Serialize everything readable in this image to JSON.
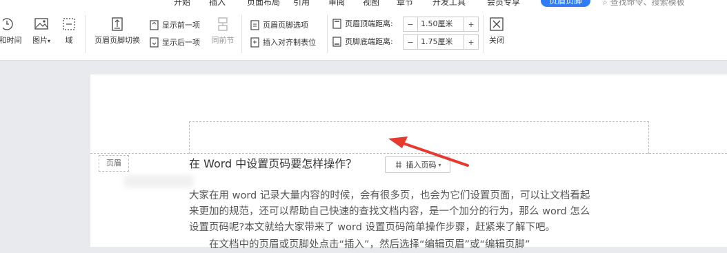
{
  "ribbon_tabs": [
    "开始",
    "插入",
    "页面布局",
    "引用",
    "审阅",
    "视图",
    "章节",
    "开发工具",
    "会员专享",
    "页眉页脚"
  ],
  "search_placeholder": "查找命令、搜索模板",
  "toolbar": {
    "datetime": "和时间",
    "picture": "图片",
    "field": "域",
    "switch": "页眉页脚切换",
    "show_prev": "显示前一项",
    "show_next": "显示后一项",
    "same_prev": "同前节",
    "options": "页眉页脚选项",
    "insert_tab": "插入对齐制表位",
    "header_top_label": "页眉顶端距离:",
    "footer_bottom_label": "页脚底端距离:",
    "header_top_value": "1.50厘米",
    "footer_bottom_value": "1.75厘米",
    "close": "关闭",
    "minus": "−",
    "plus": "+"
  },
  "document": {
    "header_tag": "页眉",
    "title": "在 Word 中设置页码要怎样操作？",
    "insert_page_number": "插入页码",
    "lines": [
      "大家在用 word 记录大量内容的时候，会有很多页，也会为它们设置页面，可以让文档看起",
      "来更加的规范，还可以帮助自己快速的查找文档内容，是一个加分的行为，那么 word 怎么",
      "设置页码呢?本文就给大家带来了 word 设置页码简单操作步骤，赶紧来了解下吧。",
      "　　在文档中的页眉或页脚处点击“插入”，然后选择“编辑页眉”或“编辑页脚”"
    ]
  },
  "colors": {
    "accent": "#2f7cf6",
    "arrow": "#e8392f"
  }
}
